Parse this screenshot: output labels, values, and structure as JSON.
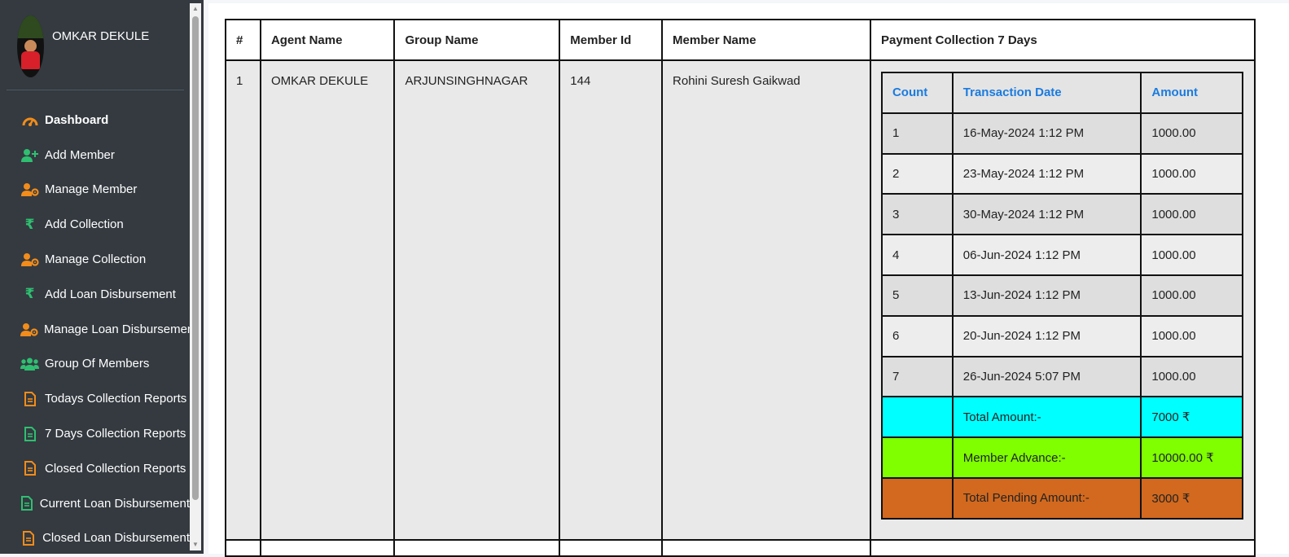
{
  "sidebar": {
    "user_name": "OMKAR DEKULE",
    "items": [
      {
        "label": "Dashboard",
        "icon": "gauge-icon",
        "color": "#f28c1a"
      },
      {
        "label": "Add Member",
        "icon": "user-plus-icon",
        "color": "#2fbf71"
      },
      {
        "label": "Manage Member",
        "icon": "user-gear-icon",
        "color": "#f28c1a"
      },
      {
        "label": "Add Collection",
        "icon": "rupee-icon",
        "color": "#2fbf71"
      },
      {
        "label": "Manage Collection",
        "icon": "user-gear-icon",
        "color": "#f28c1a"
      },
      {
        "label": "Add Loan Disbursement",
        "icon": "rupee-icon",
        "color": "#2fbf71"
      },
      {
        "label": "Manage Loan Disbursement",
        "icon": "user-gear-icon",
        "color": "#f28c1a"
      },
      {
        "label": "Group Of Members",
        "icon": "users-icon",
        "color": "#2fbf71"
      },
      {
        "label": "Todays Collection Reports",
        "icon": "file-icon",
        "color": "#f28c1a"
      },
      {
        "label": "7 Days Collection Reports",
        "icon": "file-icon",
        "color": "#2fbf71"
      },
      {
        "label": "Closed Collection Reports",
        "icon": "file-icon",
        "color": "#f28c1a"
      },
      {
        "label": "Current Loan Disbursement",
        "icon": "file-icon",
        "color": "#2fbf71"
      },
      {
        "label": "Closed Loan Disbursement",
        "icon": "file-icon",
        "color": "#f28c1a"
      }
    ]
  },
  "table": {
    "headers": [
      "#",
      "Agent Name",
      "Group Name",
      "Member Id",
      "Member Name",
      "Payment Collection 7 Days"
    ],
    "row": {
      "index": "1",
      "agent_name": "OMKAR DEKULE",
      "group_name": "ARJUNSINGHNAGAR",
      "member_id": "144",
      "member_name": "Rohini Suresh Gaikwad"
    },
    "sub_headers": [
      "Count",
      "Transaction Date",
      "Amount"
    ],
    "transactions": [
      {
        "count": "1",
        "date": "16-May-2024 1:12 PM",
        "amount": "1000.00"
      },
      {
        "count": "2",
        "date": "23-May-2024 1:12 PM",
        "amount": "1000.00"
      },
      {
        "count": "3",
        "date": "30-May-2024 1:12 PM",
        "amount": "1000.00"
      },
      {
        "count": "4",
        "date": "06-Jun-2024 1:12 PM",
        "amount": "1000.00"
      },
      {
        "count": "5",
        "date": "13-Jun-2024 1:12 PM",
        "amount": "1000.00"
      },
      {
        "count": "6",
        "date": "20-Jun-2024 1:12 PM",
        "amount": "1000.00"
      },
      {
        "count": "7",
        "date": "26-Jun-2024 5:07 PM",
        "amount": "1000.00"
      }
    ],
    "total_label": "Total Amount:-",
    "total_value": "7000 ₹",
    "advance_label": "Member Advance:-",
    "advance_value": "10000.00 ₹",
    "pending_label": "Total Pending Amount:-",
    "pending_value": "3000 ₹"
  },
  "colors": {
    "sidebar_bg": "#343a40",
    "sub_header_text": "#1a7be0",
    "total_bg": "#00ffff",
    "advance_bg": "#7fff00",
    "pending_bg": "#d2691e"
  }
}
